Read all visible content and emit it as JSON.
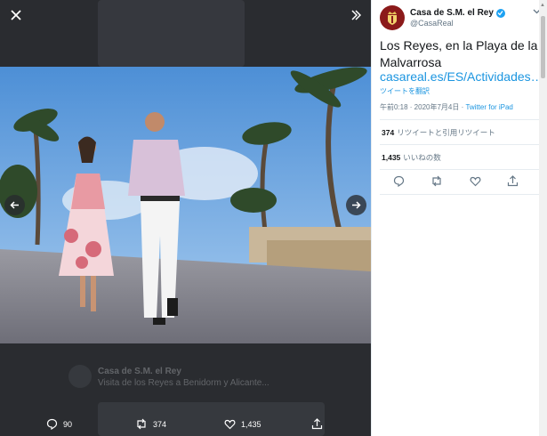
{
  "viewer": {
    "close_label": "✕",
    "expand_label": "»",
    "prev_label": "←",
    "next_label": "→",
    "actions": {
      "reply_count": "90",
      "retweet_count": "374",
      "like_count": "1,435"
    },
    "background_tweet": {
      "author": "Casa de S.M. el Rey",
      "handle": "@CasaReal",
      "text": "Visita de los Reyes a Benidorm y Alicante..."
    }
  },
  "panel": {
    "author_name": "Casa de S.M. el Rey",
    "author_handle": "@CasaReal",
    "tweet_text": "Los Reyes, en la Playa de la Malvarrosa",
    "tweet_link": "casareal.es/ES/Actividades…",
    "translate_label": "ツイートを翻訳",
    "timestamp": "午前0:18 · 2020年7月4日",
    "source_sep": " · ",
    "source": "Twitter for iPad",
    "retweets_count": "374",
    "retweets_label": "リツイートと引用リツイート",
    "likes_count": "1,435",
    "likes_label": "いいねの数"
  },
  "colors": {
    "accent": "#1da1f2",
    "link": "#1b95e0",
    "viewer_bg": "#2a2c30"
  }
}
